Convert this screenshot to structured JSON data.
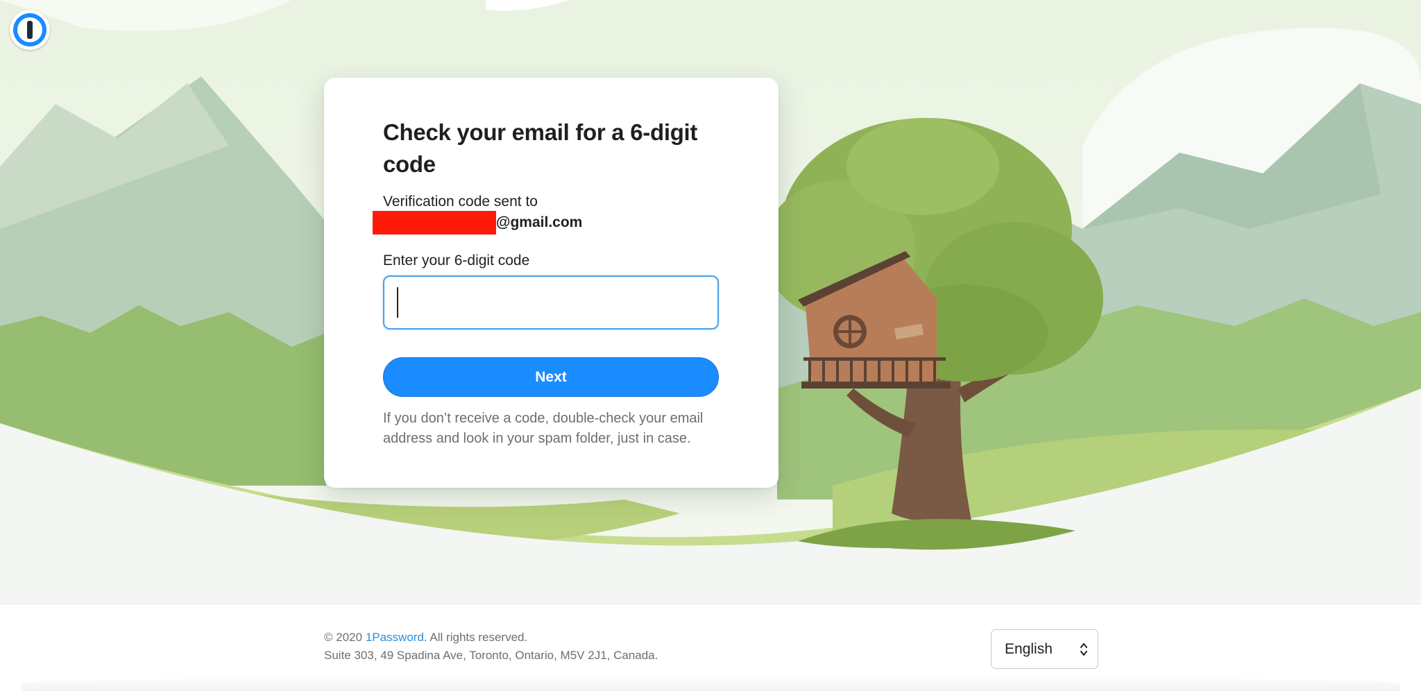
{
  "app": {
    "logo_icon": "1password-logo-icon"
  },
  "card": {
    "title": "Check your email for a 6-digit code",
    "sent_label": "Verification code sent to",
    "email_domain": "@gmail.com",
    "code_label": "Enter your 6-digit code",
    "code_value": "",
    "next_label": "Next",
    "hint": "If you don’t receive a code, double-check your email address and look in your spam folder, just in case."
  },
  "footer": {
    "copyright_prefix": "© 2020",
    "brand_link": "1Password",
    "copyright_suffix": ". All rights reserved.",
    "address": "Suite 303, 49 Spadina Ave, Toronto, Ontario, M5V 2J1, Canada.",
    "language": "English"
  },
  "colors": {
    "accent": "#1a8cff",
    "redaction": "#ff1a0a",
    "link": "#2b8de0"
  }
}
